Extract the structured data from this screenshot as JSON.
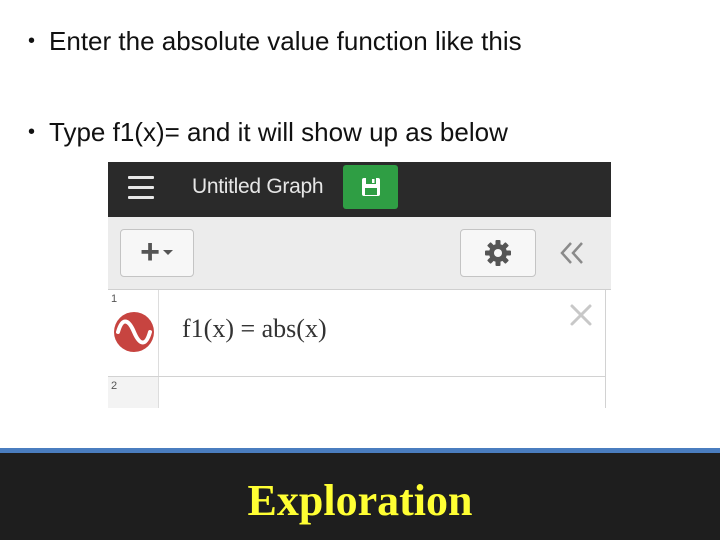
{
  "bullets": [
    {
      "symbol": "•",
      "text": "Enter the absolute value function like this"
    },
    {
      "symbol": "•",
      "text": "Type f1(x)= and it will show up as below"
    }
  ],
  "app": {
    "title": "Untitled Graph",
    "add_label": "+",
    "expressions": [
      {
        "number": "1",
        "text": "f1(x) = abs(x)",
        "icon_color": "#c74440"
      },
      {
        "number": "2",
        "text": ""
      }
    ]
  },
  "icons": {
    "menu": "hamburger-icon",
    "save": "floppy-disk-icon",
    "add": "plus-icon",
    "add_dropdown": "caret-down-icon",
    "settings": "gear-icon",
    "collapse": "double-chevron-left-icon",
    "expression_style": "sine-wave-icon",
    "delete": "close-icon"
  },
  "colors": {
    "save_button": "#2f9e44",
    "expression_icon": "#c74440",
    "footer_text": "#ffff33",
    "footer_rule": "#4a7dbf"
  },
  "footer": {
    "title": "Exploration"
  }
}
